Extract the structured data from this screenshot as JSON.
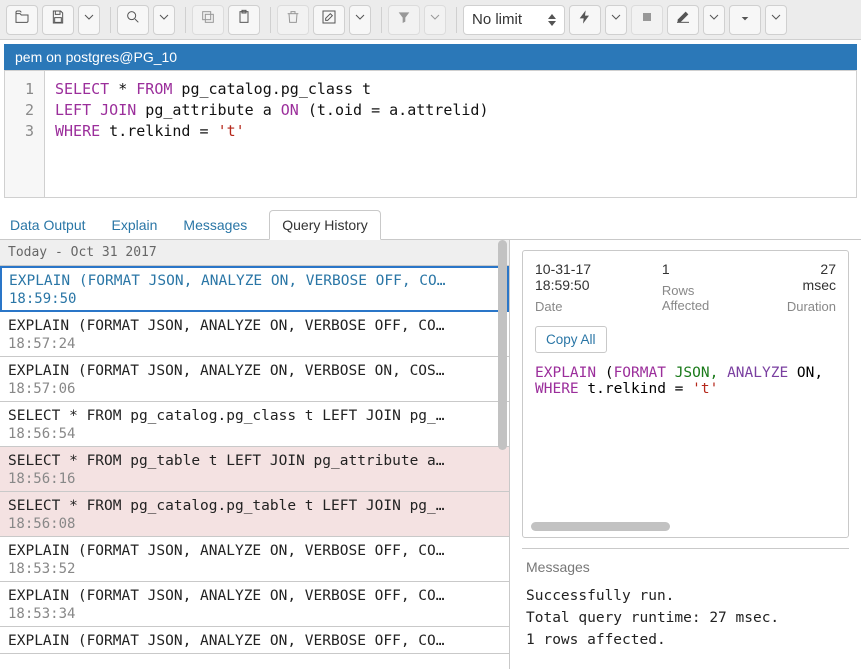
{
  "toolbar": {
    "limit_label": "No limit"
  },
  "connection": {
    "label": "pem on postgres@PG_10"
  },
  "editor": {
    "lines": {
      "l1": {
        "a": "SELECT",
        "b": " * ",
        "c": "FROM",
        "d": " pg_catalog.pg_class t"
      },
      "l2": {
        "a": "LEFT JOIN",
        "b": " pg_attribute a ",
        "c": "ON",
        "d": " (t.oid = a.attrelid)"
      },
      "l3": {
        "a": "WHERE",
        "b": " t.relkind = ",
        "c": "'t'"
      }
    },
    "gutter": {
      "n1": "1",
      "n2": "2",
      "n3": "3"
    }
  },
  "tabs": {
    "data_output": "Data Output",
    "explain": "Explain",
    "messages": "Messages",
    "query_history": "Query History"
  },
  "history": {
    "date_header": "Today - Oct 31 2017",
    "items": [
      {
        "q": "EXPLAIN (FORMAT JSON, ANALYZE ON, VERBOSE OFF, CO…",
        "ts": "18:59:50",
        "selected": true,
        "error": false
      },
      {
        "q": "EXPLAIN (FORMAT JSON, ANALYZE ON, VERBOSE OFF, CO…",
        "ts": "18:57:24",
        "selected": false,
        "error": false
      },
      {
        "q": "EXPLAIN (FORMAT JSON, ANALYZE ON, VERBOSE ON, COS…",
        "ts": "18:57:06",
        "selected": false,
        "error": false
      },
      {
        "q": "SELECT * FROM pg_catalog.pg_class t LEFT JOIN pg_…",
        "ts": "18:56:54",
        "selected": false,
        "error": false
      },
      {
        "q": "SELECT * FROM pg_table t LEFT JOIN pg_attribute a…",
        "ts": "18:56:16",
        "selected": false,
        "error": true
      },
      {
        "q": "SELECT * FROM pg_catalog.pg_table t LEFT JOIN pg_…",
        "ts": "18:56:08",
        "selected": false,
        "error": true
      },
      {
        "q": "EXPLAIN (FORMAT JSON, ANALYZE ON, VERBOSE OFF, CO…",
        "ts": "18:53:52",
        "selected": false,
        "error": false
      },
      {
        "q": "EXPLAIN (FORMAT JSON, ANALYZE ON, VERBOSE OFF, CO…",
        "ts": "18:53:34",
        "selected": false,
        "error": false
      },
      {
        "q": "EXPLAIN (FORMAT JSON, ANALYZE ON, VERBOSE OFF, CO…",
        "ts": "",
        "selected": false,
        "error": false
      }
    ]
  },
  "detail": {
    "date_value": "10-31-17 18:59:50",
    "date_label": "Date",
    "rows_value": "1",
    "rows_label": "Rows Affected",
    "dur_value": "27 msec",
    "dur_label": "Duration",
    "copy": "Copy All",
    "sql": {
      "l1": {
        "a": "EXPLAIN",
        "b": " (",
        "c": "FORMAT",
        "d": " JSON, ",
        "e": "ANALYZE",
        "f": " ON,"
      },
      "l2": {
        "a": "WHERE",
        "b": " t.relkind = ",
        "c": "'t'"
      }
    }
  },
  "messages": {
    "title": "Messages",
    "l1": "Successfully run.",
    "l2": "Total query runtime: 27 msec.",
    "l3": "1 rows affected."
  }
}
